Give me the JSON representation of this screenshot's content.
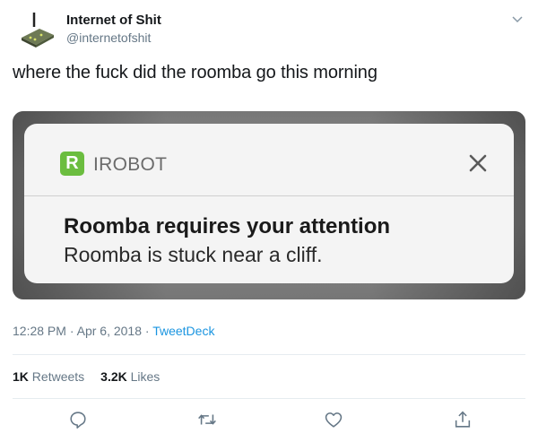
{
  "author": {
    "display_name": "Internet of Shit",
    "handle": "@internetofshit"
  },
  "tweet": {
    "text": "where the fuck did the roomba go this morning"
  },
  "notification": {
    "app_name": "IROBOT",
    "app_icon_letter": "R",
    "app_icon_color": "#6bbd3f",
    "title": "Roomba requires your attention",
    "body": "Roomba is stuck near a cliff."
  },
  "meta": {
    "time": "12:28 PM",
    "date": "Apr 6, 2018",
    "separator": " · ",
    "source": "TweetDeck"
  },
  "stats": {
    "retweets_count": "1K",
    "retweets_label": "Retweets",
    "likes_count": "3.2K",
    "likes_label": "Likes"
  },
  "colors": {
    "link": "#1b95e0",
    "secondary_text": "#657786"
  },
  "icons": {
    "reply": "reply-icon",
    "retweet": "retweet-icon",
    "like": "heart-icon",
    "share": "share-icon",
    "menu": "chevron-down-icon"
  }
}
